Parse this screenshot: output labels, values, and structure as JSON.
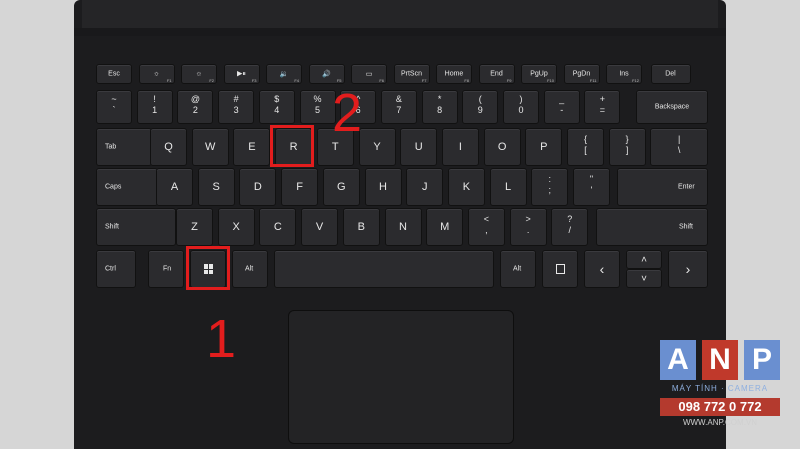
{
  "keyboard": {
    "row_fn": [
      {
        "label": "Esc"
      },
      {
        "label": "☼",
        "sub": "F1"
      },
      {
        "label": "☼",
        "sub": "F2"
      },
      {
        "label": "▶⏸",
        "sub": "F3"
      },
      {
        "label": "🔉",
        "sub": "F4"
      },
      {
        "label": "🔊",
        "sub": "F5"
      },
      {
        "label": "▭",
        "sub": "F6"
      },
      {
        "label": "PrtScn",
        "sub": "F7"
      },
      {
        "label": "Home",
        "sub": "F8"
      },
      {
        "label": "End",
        "sub": "F9"
      },
      {
        "label": "PgUp",
        "sub": "F10"
      },
      {
        "label": "PgDn",
        "sub": "F11"
      },
      {
        "label": "Ins",
        "sub": "F12"
      },
      {
        "label": "Del"
      }
    ],
    "row_num": [
      {
        "top": "~",
        "bottom": "`"
      },
      {
        "top": "!",
        "bottom": "1"
      },
      {
        "top": "@",
        "bottom": "2"
      },
      {
        "top": "#",
        "bottom": "3"
      },
      {
        "top": "$",
        "bottom": "4"
      },
      {
        "top": "%",
        "bottom": "5"
      },
      {
        "top": "^",
        "bottom": "6"
      },
      {
        "top": "&",
        "bottom": "7"
      },
      {
        "top": "*",
        "bottom": "8"
      },
      {
        "top": "(",
        "bottom": "9"
      },
      {
        "top": ")",
        "bottom": "0"
      },
      {
        "top": "_",
        "bottom": "-"
      },
      {
        "top": "+",
        "bottom": "="
      }
    ],
    "backspace": "Backspace",
    "tab": "Tab",
    "row_q": [
      "Q",
      "W",
      "E",
      "R",
      "T",
      "Y",
      "U",
      "I",
      "O",
      "P"
    ],
    "row_q_sym": [
      {
        "top": "{",
        "bottom": "["
      },
      {
        "top": "}",
        "bottom": "]"
      },
      {
        "top": "|",
        "bottom": "\\"
      }
    ],
    "caps": "Caps",
    "row_a": [
      "A",
      "S",
      "D",
      "F",
      "G",
      "H",
      "J",
      "K",
      "L"
    ],
    "row_a_sym": [
      {
        "top": ":",
        "bottom": ";"
      },
      {
        "top": "\"",
        "bottom": "'"
      }
    ],
    "enter": "Enter",
    "shift_left": "Shift",
    "row_z": [
      "Z",
      "X",
      "C",
      "V",
      "B",
      "N",
      "M"
    ],
    "row_z_sym": [
      {
        "top": "<",
        "bottom": ","
      },
      {
        "top": ">",
        "bottom": "."
      },
      {
        "top": "?",
        "bottom": "/"
      }
    ],
    "shift_right": "Shift",
    "ctrl": "Ctrl",
    "fn": "Fn",
    "alt_left": "Alt",
    "alt_right": "Alt",
    "menu_icon": "menu-icon",
    "arrow_left": "‹",
    "arrow_up": "˄",
    "arrow_down": "˅",
    "arrow_right": "›"
  },
  "annotations": {
    "step1": "1",
    "step2": "2",
    "highlight_color": "#e21d1d"
  },
  "watermark": {
    "letters": [
      "A",
      "N",
      "P"
    ],
    "letter_colors": [
      "#6a8fd0",
      "#c0392b",
      "#6a8fd0"
    ],
    "line1": "MÁY TÍNH · CAMERA",
    "phone": "098 772 0 772",
    "site": "WWW.ANP.COM.VN"
  }
}
